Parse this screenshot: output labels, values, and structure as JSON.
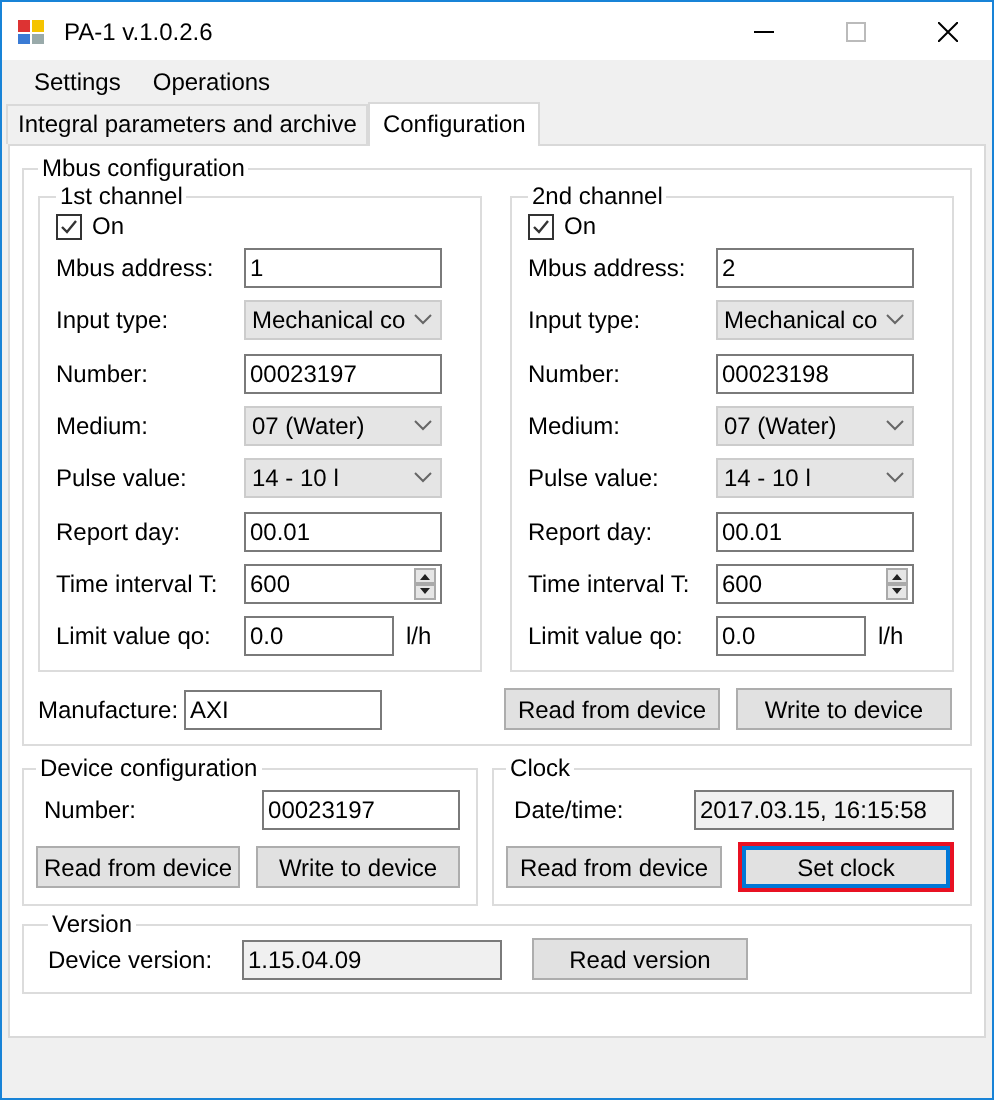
{
  "window": {
    "title": "PA-1 v.1.0.2.6"
  },
  "menu": [
    "Settings",
    "Operations"
  ],
  "tabs": [
    {
      "label": "Integral parameters and archive",
      "selected": false
    },
    {
      "label": "Configuration",
      "selected": true
    }
  ],
  "mbus": {
    "title": "Mbus configuration",
    "channels": [
      {
        "title": "1st channel",
        "on_label": "On",
        "on": true,
        "fields": [
          {
            "kind": "text",
            "label": "Mbus address:",
            "value": "1"
          },
          {
            "kind": "dropdown",
            "label": "Input type:",
            "value": "Mechanical co"
          },
          {
            "kind": "text",
            "label": "Number:",
            "value": "00023197"
          },
          {
            "kind": "dropdown",
            "label": "Medium:",
            "value": "07 (Water)"
          },
          {
            "kind": "dropdown",
            "label": "Pulse value:",
            "value": "14 - 10 l"
          },
          {
            "kind": "text",
            "label": "Report day:",
            "value": "00.01"
          },
          {
            "kind": "spin",
            "label": "Time interval T:",
            "value": "600"
          },
          {
            "kind": "unit",
            "label": "Limit value qo:",
            "value": "0.0",
            "unit": "l/h"
          }
        ]
      },
      {
        "title": "2nd channel",
        "on_label": "On",
        "on": true,
        "fields": [
          {
            "kind": "text",
            "label": "Mbus address:",
            "value": "2"
          },
          {
            "kind": "dropdown",
            "label": "Input type:",
            "value": "Mechanical co"
          },
          {
            "kind": "text",
            "label": "Number:",
            "value": "00023198"
          },
          {
            "kind": "dropdown",
            "label": "Medium:",
            "value": "07 (Water)"
          },
          {
            "kind": "dropdown",
            "label": "Pulse value:",
            "value": "14 - 10 l"
          },
          {
            "kind": "text",
            "label": "Report day:",
            "value": "00.01"
          },
          {
            "kind": "spin",
            "label": "Time interval T:",
            "value": "600"
          },
          {
            "kind": "unit",
            "label": "Limit value qo:",
            "value": "0.0",
            "unit": "l/h"
          }
        ]
      }
    ],
    "manufacture": {
      "label": "Manufacture:",
      "value": "AXI"
    },
    "buttons": [
      "Read from device",
      "Write to device"
    ]
  },
  "device_config": {
    "title": "Device configuration",
    "label": "Number:",
    "value": "00023197",
    "buttons": [
      "Read from device",
      "Write to device"
    ]
  },
  "clock": {
    "title": "Clock",
    "label": "Date/time:",
    "value": "2017.03.15, 16:15:58",
    "readonly": true,
    "buttons": [
      {
        "label": "Read from device",
        "highlighted": false
      },
      {
        "label": "Set clock",
        "highlighted": true
      }
    ]
  },
  "version": {
    "title": "Version",
    "label": "Device version:",
    "value": "1.15.04.09",
    "readonly": true,
    "button": "Read version"
  }
}
